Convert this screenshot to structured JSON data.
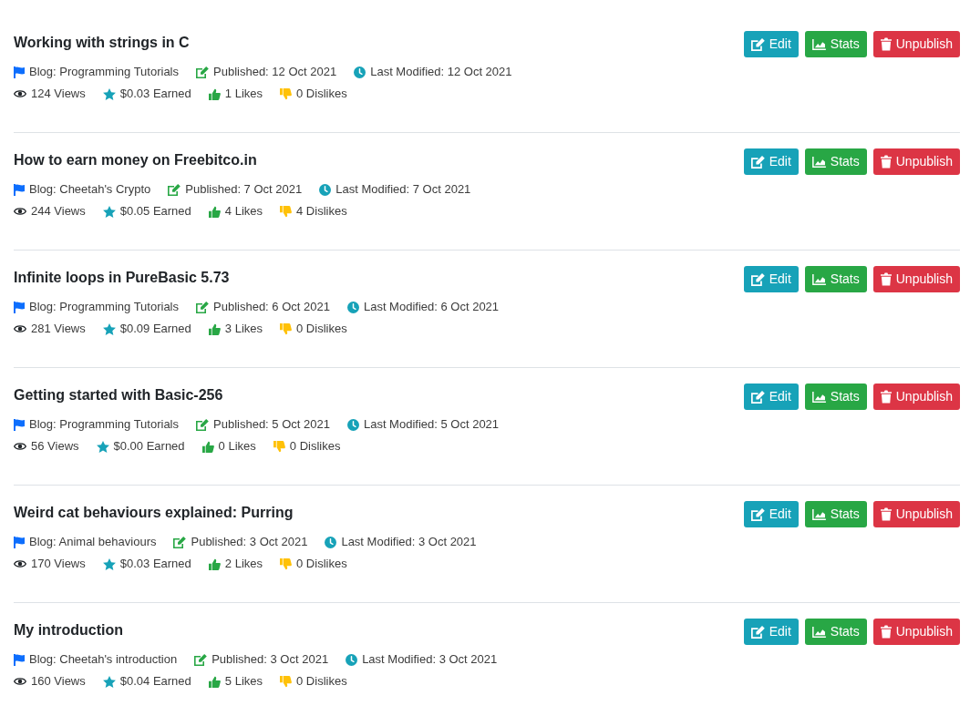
{
  "posts": [
    {
      "title": "Working with strings in C",
      "info": [
        {
          "kind": "blog",
          "text": "Blog: Programming Tutorials"
        },
        {
          "kind": "published",
          "text": "Published: 12 Oct 2021"
        },
        {
          "kind": "modified",
          "text": "Last Modified: 12 Oct 2021"
        }
      ],
      "stats": [
        {
          "kind": "views",
          "text": "124 Views"
        },
        {
          "kind": "earned",
          "text": "$0.03 Earned"
        },
        {
          "kind": "likes",
          "text": "1 Likes"
        },
        {
          "kind": "dislikes",
          "text": "0 Dislikes"
        }
      ],
      "actions": [
        {
          "kind": "edit",
          "label": "Edit"
        },
        {
          "kind": "stats",
          "label": "Stats"
        },
        {
          "kind": "unpublish",
          "label": "Unpublish"
        }
      ]
    },
    {
      "title": "How to earn money on Freebitco.in",
      "info": [
        {
          "kind": "blog",
          "text": "Blog: Cheetah's Crypto"
        },
        {
          "kind": "published",
          "text": "Published: 7 Oct 2021"
        },
        {
          "kind": "modified",
          "text": "Last Modified: 7 Oct 2021"
        }
      ],
      "stats": [
        {
          "kind": "views",
          "text": "244 Views"
        },
        {
          "kind": "earned",
          "text": "$0.05 Earned"
        },
        {
          "kind": "likes",
          "text": "4 Likes"
        },
        {
          "kind": "dislikes",
          "text": "4 Dislikes"
        }
      ],
      "actions": [
        {
          "kind": "edit",
          "label": "Edit"
        },
        {
          "kind": "stats",
          "label": "Stats"
        },
        {
          "kind": "unpublish",
          "label": "Unpublish"
        }
      ]
    },
    {
      "title": "Infinite loops in PureBasic 5.73",
      "info": [
        {
          "kind": "blog",
          "text": "Blog: Programming Tutorials"
        },
        {
          "kind": "published",
          "text": "Published: 6 Oct 2021"
        },
        {
          "kind": "modified",
          "text": "Last Modified: 6 Oct 2021"
        }
      ],
      "stats": [
        {
          "kind": "views",
          "text": "281 Views"
        },
        {
          "kind": "earned",
          "text": "$0.09 Earned"
        },
        {
          "kind": "likes",
          "text": "3 Likes"
        },
        {
          "kind": "dislikes",
          "text": "0 Dislikes"
        }
      ],
      "actions": [
        {
          "kind": "edit",
          "label": "Edit"
        },
        {
          "kind": "stats",
          "label": "Stats"
        },
        {
          "kind": "unpublish",
          "label": "Unpublish"
        }
      ]
    },
    {
      "title": "Getting started with Basic-256",
      "info": [
        {
          "kind": "blog",
          "text": "Blog: Programming Tutorials"
        },
        {
          "kind": "published",
          "text": "Published: 5 Oct 2021"
        },
        {
          "kind": "modified",
          "text": "Last Modified: 5 Oct 2021"
        }
      ],
      "stats": [
        {
          "kind": "views",
          "text": "56 Views"
        },
        {
          "kind": "earned",
          "text": "$0.00 Earned"
        },
        {
          "kind": "likes",
          "text": "0 Likes"
        },
        {
          "kind": "dislikes",
          "text": "0 Dislikes"
        }
      ],
      "actions": [
        {
          "kind": "edit",
          "label": "Edit"
        },
        {
          "kind": "stats",
          "label": "Stats"
        },
        {
          "kind": "unpublish",
          "label": "Unpublish"
        }
      ]
    },
    {
      "title": "Weird cat behaviours explained: Purring",
      "info": [
        {
          "kind": "blog",
          "text": "Blog: Animal behaviours"
        },
        {
          "kind": "published",
          "text": "Published: 3 Oct 2021"
        },
        {
          "kind": "modified",
          "text": "Last Modified: 3 Oct 2021"
        }
      ],
      "stats": [
        {
          "kind": "views",
          "text": "170 Views"
        },
        {
          "kind": "earned",
          "text": "$0.03 Earned"
        },
        {
          "kind": "likes",
          "text": "2 Likes"
        },
        {
          "kind": "dislikes",
          "text": "0 Dislikes"
        }
      ],
      "actions": [
        {
          "kind": "edit",
          "label": "Edit"
        },
        {
          "kind": "stats",
          "label": "Stats"
        },
        {
          "kind": "unpublish",
          "label": "Unpublish"
        }
      ]
    },
    {
      "title": "My introduction",
      "info": [
        {
          "kind": "blog",
          "text": "Blog: Cheetah's introduction"
        },
        {
          "kind": "published",
          "text": "Published: 3 Oct 2021"
        },
        {
          "kind": "modified",
          "text": "Last Modified: 3 Oct 2021"
        }
      ],
      "stats": [
        {
          "kind": "views",
          "text": "160 Views"
        },
        {
          "kind": "earned",
          "text": "$0.04 Earned"
        },
        {
          "kind": "likes",
          "text": "5 Likes"
        },
        {
          "kind": "dislikes",
          "text": "0 Dislikes"
        }
      ],
      "actions": [
        {
          "kind": "edit",
          "label": "Edit"
        },
        {
          "kind": "stats",
          "label": "Stats"
        },
        {
          "kind": "unpublish",
          "label": "Unpublish"
        }
      ]
    }
  ]
}
